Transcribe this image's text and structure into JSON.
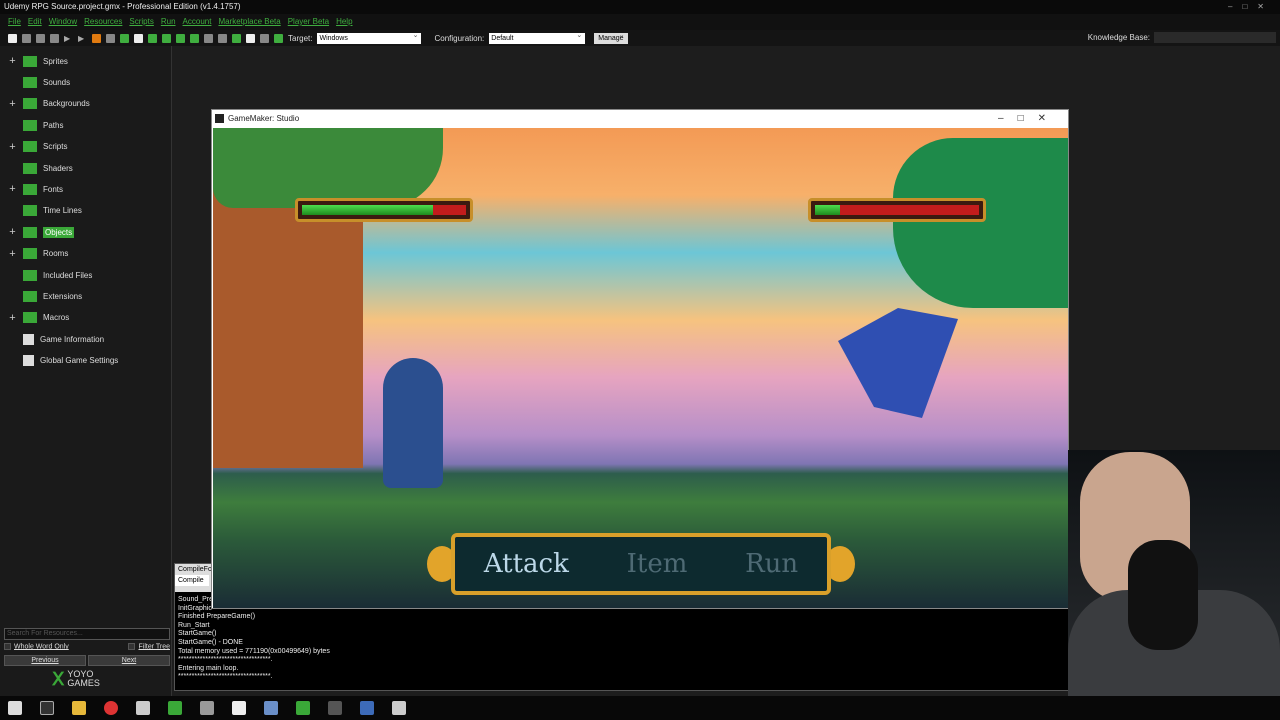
{
  "window": {
    "title": "Udemy RPG Source.project.gmx  -  Professional Edition (v1.4.1757)"
  },
  "menu": [
    "File",
    "Edit",
    "Window",
    "Resources",
    "Scripts",
    "Run",
    "Account",
    "Marketplace Beta",
    "Player Beta",
    "Help"
  ],
  "toolbar": {
    "target_label": "Target:",
    "target_value": "Windows",
    "config_label": "Configuration:",
    "config_value": "Default",
    "manage": "Manage",
    "knowledge_label": "Knowledge Base:"
  },
  "tree": [
    {
      "label": "Sprites",
      "expand": true,
      "folder": true
    },
    {
      "label": "Sounds",
      "expand": false,
      "folder": true
    },
    {
      "label": "Backgrounds",
      "expand": true,
      "folder": true
    },
    {
      "label": "Paths",
      "expand": false,
      "folder": true
    },
    {
      "label": "Scripts",
      "expand": true,
      "folder": true
    },
    {
      "label": "Shaders",
      "expand": false,
      "folder": true
    },
    {
      "label": "Fonts",
      "expand": true,
      "folder": true
    },
    {
      "label": "Time Lines",
      "expand": false,
      "folder": true
    },
    {
      "label": "Objects",
      "expand": true,
      "folder": true,
      "active": true
    },
    {
      "label": "Rooms",
      "expand": true,
      "folder": true
    },
    {
      "label": "Included Files",
      "expand": false,
      "folder": true
    },
    {
      "label": "Extensions",
      "expand": false,
      "folder": true
    },
    {
      "label": "Macros",
      "expand": true,
      "folder": true
    },
    {
      "label": "Game Information",
      "expand": false,
      "folder": false
    },
    {
      "label": "Global Game Settings",
      "expand": false,
      "folder": false
    }
  ],
  "search": {
    "placeholder": "Search For Resources...",
    "whole_word": "Whole Word Only",
    "filter_tree": "Filter Tree",
    "previous": "Previous",
    "next": "Next"
  },
  "logo": {
    "line1": "YOYO",
    "line2": "GAMES"
  },
  "output": {
    "tab1": "CompileFor",
    "tab2": "Compile",
    "log": [
      "Sound_Pre",
      "InitGraphic",
      "Finished PrepareGame()",
      "Run_Start",
      "StartGame()",
      "StartGame() - DONE",
      "Total memory used = 771190(0x00499649) bytes",
      "**********************************.",
      "Entering main loop.",
      "**********************************."
    ]
  },
  "game": {
    "window_title": "GameMaker: Studio",
    "player_hp": 0.8,
    "enemy_hp": 0.15,
    "options": [
      "Attack",
      "Item",
      "Run"
    ]
  }
}
